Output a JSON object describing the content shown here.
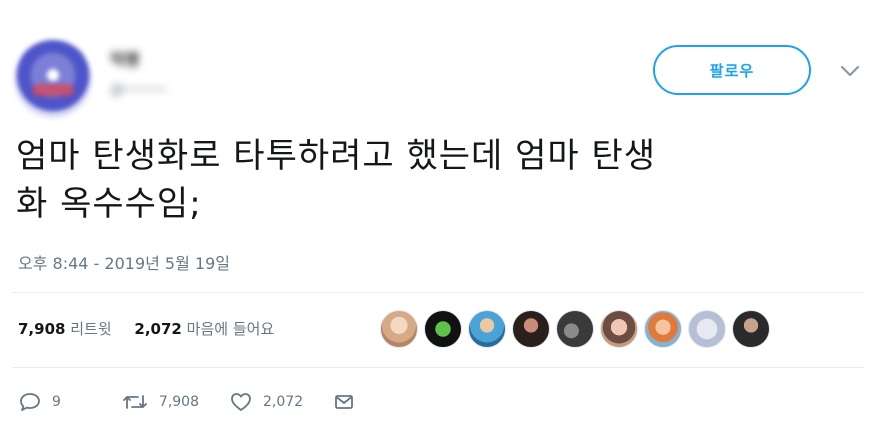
{
  "user": {
    "name": "익명",
    "handle": "@─────"
  },
  "header": {
    "follow_label": "팔로우"
  },
  "tweet": {
    "line1": "엄마 탄생화로 타투하려고 했는데 엄마 탄생",
    "line2": "화 옥수수임;",
    "timestamp": "오후 8:44 - 2019년 5월 19일"
  },
  "stats": {
    "retweets_count": "7,908",
    "retweets_label": "리트윗",
    "likes_count": "2,072",
    "likes_label": "마음에 들어요"
  },
  "actions": {
    "reply_count": "9",
    "retweet_count": "7,908",
    "like_count": "2,072"
  },
  "colors": {
    "accent": "#1da1f2",
    "secondary_text": "#657786",
    "divider": "#e6ecf0"
  },
  "icons": [
    "chevron-down-icon",
    "reply-icon",
    "retweet-icon",
    "heart-icon",
    "message-icon"
  ]
}
